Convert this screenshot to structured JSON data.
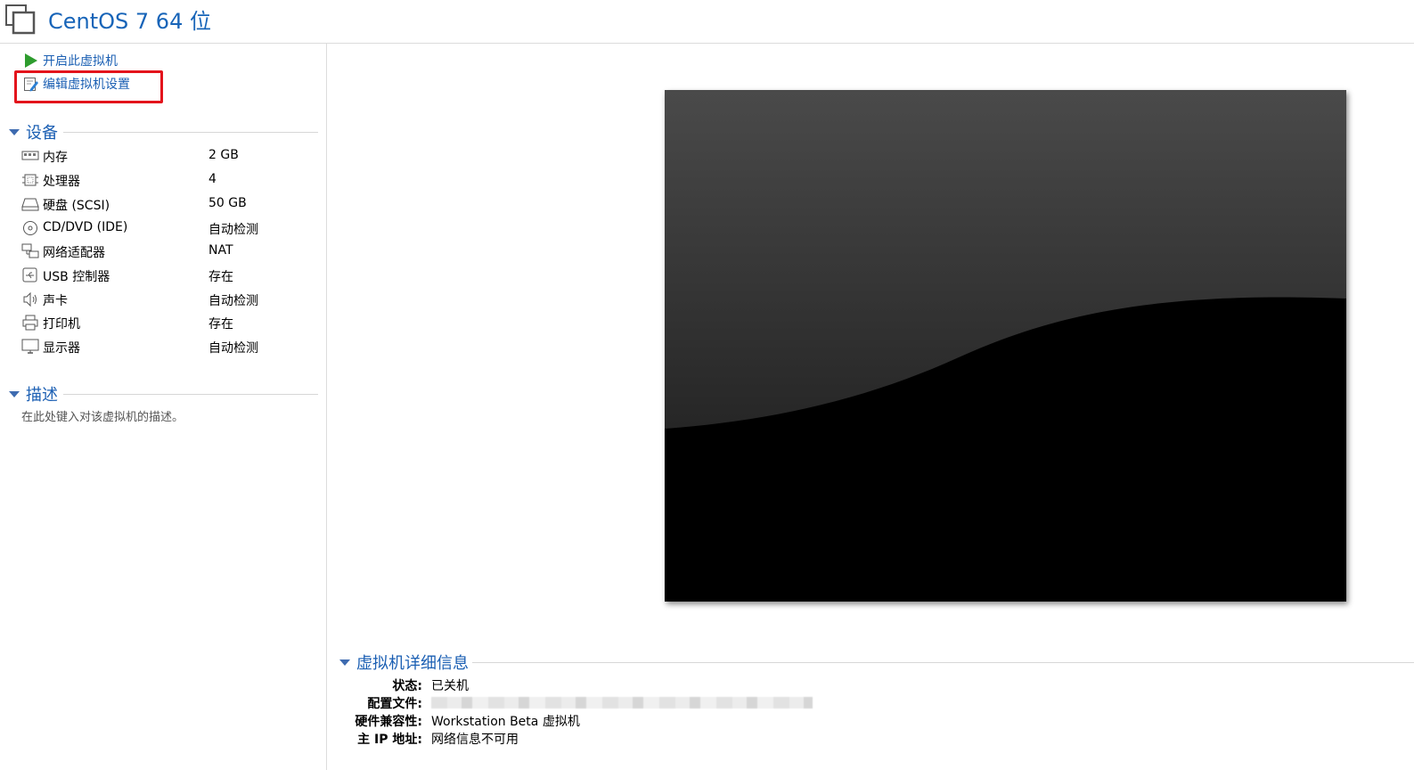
{
  "window": {
    "title": "CentOS 7 64 位"
  },
  "actions": {
    "start_vm": "开启此虚拟机",
    "edit_settings": "编辑虚拟机设置"
  },
  "devices": {
    "section_label": "设备",
    "items": [
      {
        "name": "内存",
        "value": "2 GB",
        "icon": "memory-icon"
      },
      {
        "name": "处理器",
        "value": "4",
        "icon": "cpu-icon"
      },
      {
        "name": "硬盘 (SCSI)",
        "value": "50 GB",
        "icon": "hard-disk-icon"
      },
      {
        "name": "CD/DVD (IDE)",
        "value": "自动检测",
        "icon": "cd-dvd-icon"
      },
      {
        "name": "网络适配器",
        "value": "NAT",
        "icon": "network-adapter-icon"
      },
      {
        "name": "USB 控制器",
        "value": "存在",
        "icon": "usb-icon"
      },
      {
        "name": "声卡",
        "value": "自动检测",
        "icon": "speaker-icon"
      },
      {
        "name": "打印机",
        "value": "存在",
        "icon": "printer-icon"
      },
      {
        "name": "显示器",
        "value": "自动检测",
        "icon": "monitor-icon"
      }
    ]
  },
  "description": {
    "section_label": "描述",
    "placeholder": "在此处键入对该虚拟机的描述。"
  },
  "details": {
    "section_label": "虚拟机详细信息",
    "rows": [
      {
        "key": "状态:",
        "value": "已关机"
      },
      {
        "key": "配置文件:",
        "value": ""
      },
      {
        "key": "硬件兼容性:",
        "value": "Workstation Beta 虚拟机"
      },
      {
        "key": "主 IP 地址:",
        "value": "网络信息不可用"
      }
    ]
  },
  "colors": {
    "link": "#1b5fb3",
    "title": "#1764b8",
    "highlight": "#e3141c",
    "screen": "#000000"
  }
}
